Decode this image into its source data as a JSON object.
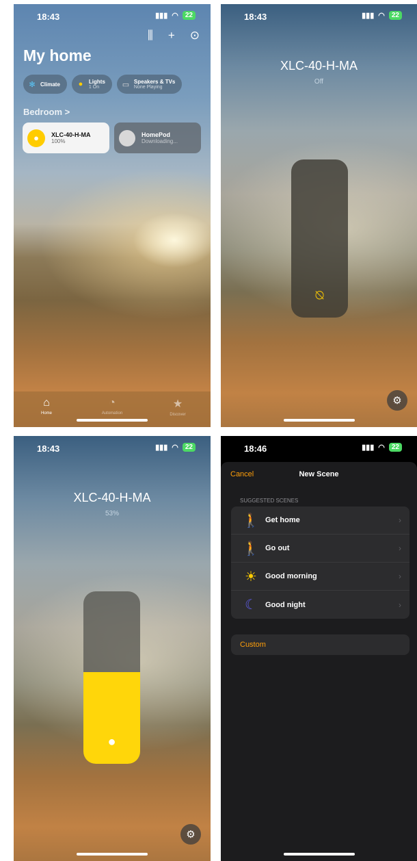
{
  "screen1": {
    "time": "18:43",
    "battery": "22",
    "title": "My home",
    "chips": [
      {
        "label": "Climate",
        "sub": "",
        "icon": "fan-icon"
      },
      {
        "label": "Lights",
        "sub": "1 On",
        "icon": "lightbulb-icon"
      },
      {
        "label": "Speakers & TVs",
        "sub": "None Playing",
        "icon": "speaker-tv-icon"
      }
    ],
    "section": "Bedroom >",
    "tiles": [
      {
        "name": "XLC-40-H-MA",
        "status": "100%"
      },
      {
        "name": "HomePod",
        "status": "Downloading..."
      }
    ],
    "tabs": [
      "Home",
      "Automation",
      "Discover"
    ]
  },
  "screen2": {
    "time": "18:43",
    "battery": "22",
    "name": "XLC-40-H-MA",
    "state": "Off",
    "brightness": 0
  },
  "screen3": {
    "time": "18:43",
    "battery": "22",
    "name": "XLC-40-H-MA",
    "state": "53%",
    "brightness": 0.53
  },
  "screen4": {
    "time": "18:46",
    "battery": "22",
    "cancel": "Cancel",
    "title": "New Scene",
    "section_header": "SUGGESTED SCENES",
    "scenes": [
      {
        "label": "Get home",
        "icon": "walking-in-icon",
        "color": "#ff9f0a"
      },
      {
        "label": "Go out",
        "icon": "walking-out-icon",
        "color": "#ff9f0a"
      },
      {
        "label": "Good morning",
        "icon": "sun-icon",
        "color": "#ffcc00"
      },
      {
        "label": "Good night",
        "icon": "moon-icon",
        "color": "#5e5ce6"
      }
    ],
    "custom": "Custom"
  },
  "colors": {
    "accent": "#ff9f0a",
    "bulb": "#ffd60a",
    "battery": "#4cd964"
  }
}
